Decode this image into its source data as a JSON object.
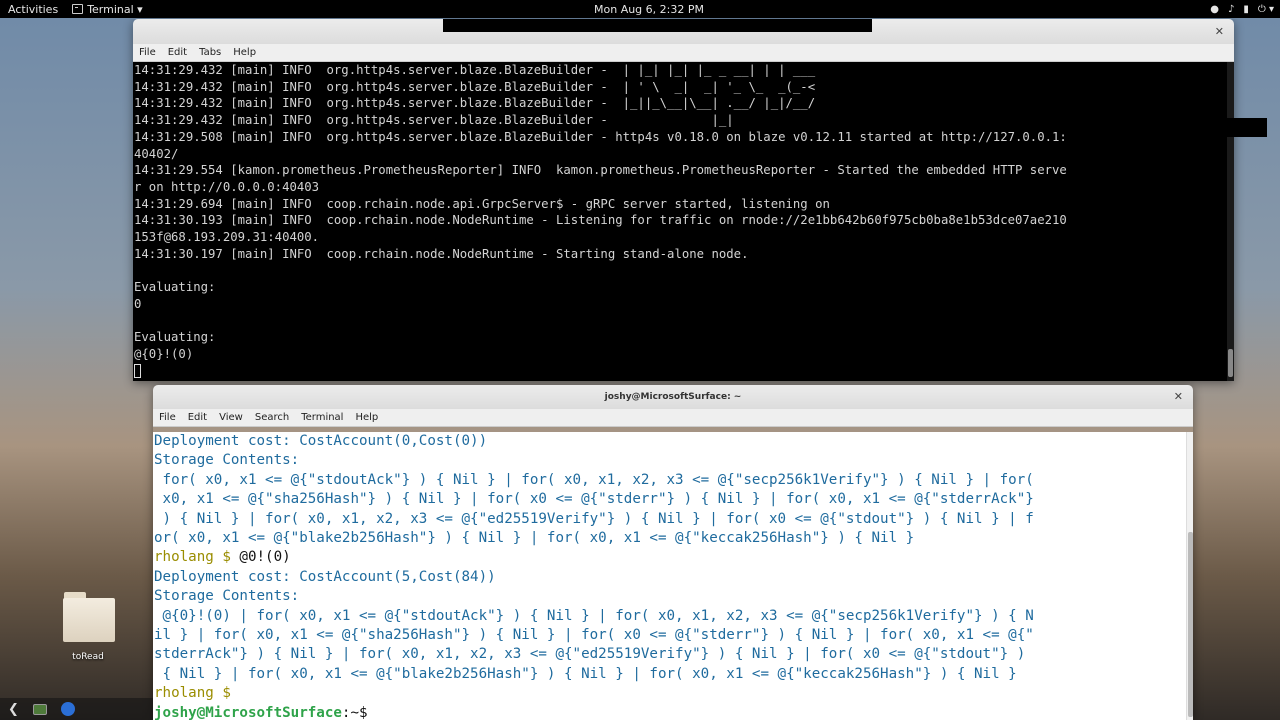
{
  "topbar": {
    "activities": "Activities",
    "app_menu": "Terminal ▾",
    "clock": "Mon Aug  6,  2:32 PM",
    "tray_icons": [
      "wifi-icon",
      "volume-icon",
      "battery-icon",
      "power-icon"
    ],
    "tray_glyphs": [
      "●",
      "♪",
      "▮",
      "⏻ ▾"
    ]
  },
  "window1": {
    "title": "",
    "menu": [
      "File",
      "Edit",
      "Tabs",
      "Help"
    ],
    "lines": [
      "14:31:29.432 [main] INFO  org.http4s.server.blaze.BlazeBuilder -  | |_| |_| |_ _ __| | | ___",
      "14:31:29.432 [main] INFO  org.http4s.server.blaze.BlazeBuilder -  | ' \\  _|  _| '_ \\_  _(_-<",
      "14:31:29.432 [main] INFO  org.http4s.server.blaze.BlazeBuilder -  |_||_\\__|\\__| .__/ |_|/__/",
      "14:31:29.432 [main] INFO  org.http4s.server.blaze.BlazeBuilder -              |_|",
      "14:31:29.508 [main] INFO  org.http4s.server.blaze.BlazeBuilder - http4s v0.18.0 on blaze v0.12.11 started at http://127.0.0.1:",
      "40402/",
      "14:31:29.554 [kamon.prometheus.PrometheusReporter] INFO  kamon.prometheus.PrometheusReporter - Started the embedded HTTP serve",
      "r on http://0.0.0.0:40403",
      "14:31:29.694 [main] INFO  coop.rchain.node.api.GrpcServer$ - gRPC server started, listening on",
      "14:31:30.193 [main] INFO  coop.rchain.node.NodeRuntime - Listening for traffic on rnode://2e1bb642b60f975cb0ba8e1b53dce07ae210",
      "153f@68.193.209.31:40400.",
      "14:31:30.197 [main] INFO  coop.rchain.node.NodeRuntime - Starting stand-alone node.",
      "",
      "Evaluating:",
      "0",
      "",
      "Evaluating:",
      "@{0}!(0)"
    ]
  },
  "window2": {
    "title": "joshy@MicrosoftSurface: ~",
    "menu": [
      "File",
      "Edit",
      "View",
      "Search",
      "Terminal",
      "Help"
    ],
    "line1": "Deployment cost: CostAccount(0,Cost(0))",
    "line2": "Storage Contents:",
    "line3": " for( x0, x1 <= @{\"stdoutAck\"} ) { Nil } | for( x0, x1, x2, x3 <= @{\"secp256k1Verify\"} ) { Nil } | for(",
    "line4": " x0, x1 <= @{\"sha256Hash\"} ) { Nil } | for( x0 <= @{\"stderr\"} ) { Nil } | for( x0, x1 <= @{\"stderrAck\"}",
    "line5": " ) { Nil } | for( x0, x1, x2, x3 <= @{\"ed25519Verify\"} ) { Nil } | for( x0 <= @{\"stdout\"} ) { Nil } | f",
    "line6": "or( x0, x1 <= @{\"blake2b256Hash\"} ) { Nil } | for( x0, x1 <= @{\"keccak256Hash\"} ) { Nil }",
    "prompt": "rholang $ ",
    "command": "@0!(0)",
    "line8": "Deployment cost: CostAccount(5,Cost(84))",
    "line9": "Storage Contents:",
    "line10": " @{0}!(0) | for( x0, x1 <= @{\"stdoutAck\"} ) { Nil } | for( x0, x1, x2, x3 <= @{\"secp256k1Verify\"} ) { N",
    "line11": "il } | for( x0, x1 <= @{\"sha256Hash\"} ) { Nil } | for( x0 <= @{\"stderr\"} ) { Nil } | for( x0, x1 <= @{\"",
    "line12": "stderrAck\"} ) { Nil } | for( x0, x1, x2, x3 <= @{\"ed25519Verify\"} ) { Nil } | for( x0 <= @{\"stdout\"} )",
    "line13": " { Nil } | for( x0, x1 <= @{\"blake2b256Hash\"} ) { Nil } | for( x0, x1 <= @{\"keccak256Hash\"} ) { Nil }",
    "prompt2": "rholang $ ",
    "shell_user": "joshy@MicrosoftSurface",
    "shell_path": ":~$",
    "shell_cursor": " "
  },
  "desktop": {
    "folder_label": "toRead"
  },
  "taskbar": {
    "back": "❮"
  }
}
